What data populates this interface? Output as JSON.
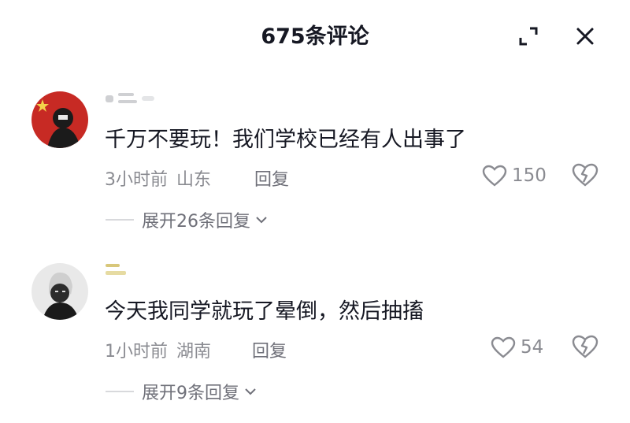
{
  "header": {
    "title": "675条评论",
    "expand_icon": "expand-icon",
    "close_icon": "close-icon"
  },
  "comments": [
    {
      "text": "千万不要玩！我们学校已经有人出事了",
      "time": "3小时前",
      "location": "山东",
      "reply_label": "回复",
      "likes": "150",
      "expand_label": "展开26条回复"
    },
    {
      "text": "今天我同学就玩了晕倒，然后抽搐",
      "time": "1小时前",
      "location": "湖南",
      "reply_label": "回复",
      "likes": "54",
      "expand_label": "展开9条回复"
    }
  ],
  "colors": {
    "text": "#161823",
    "secondary": "#8a8b91",
    "accent_red": "#d9322e"
  }
}
